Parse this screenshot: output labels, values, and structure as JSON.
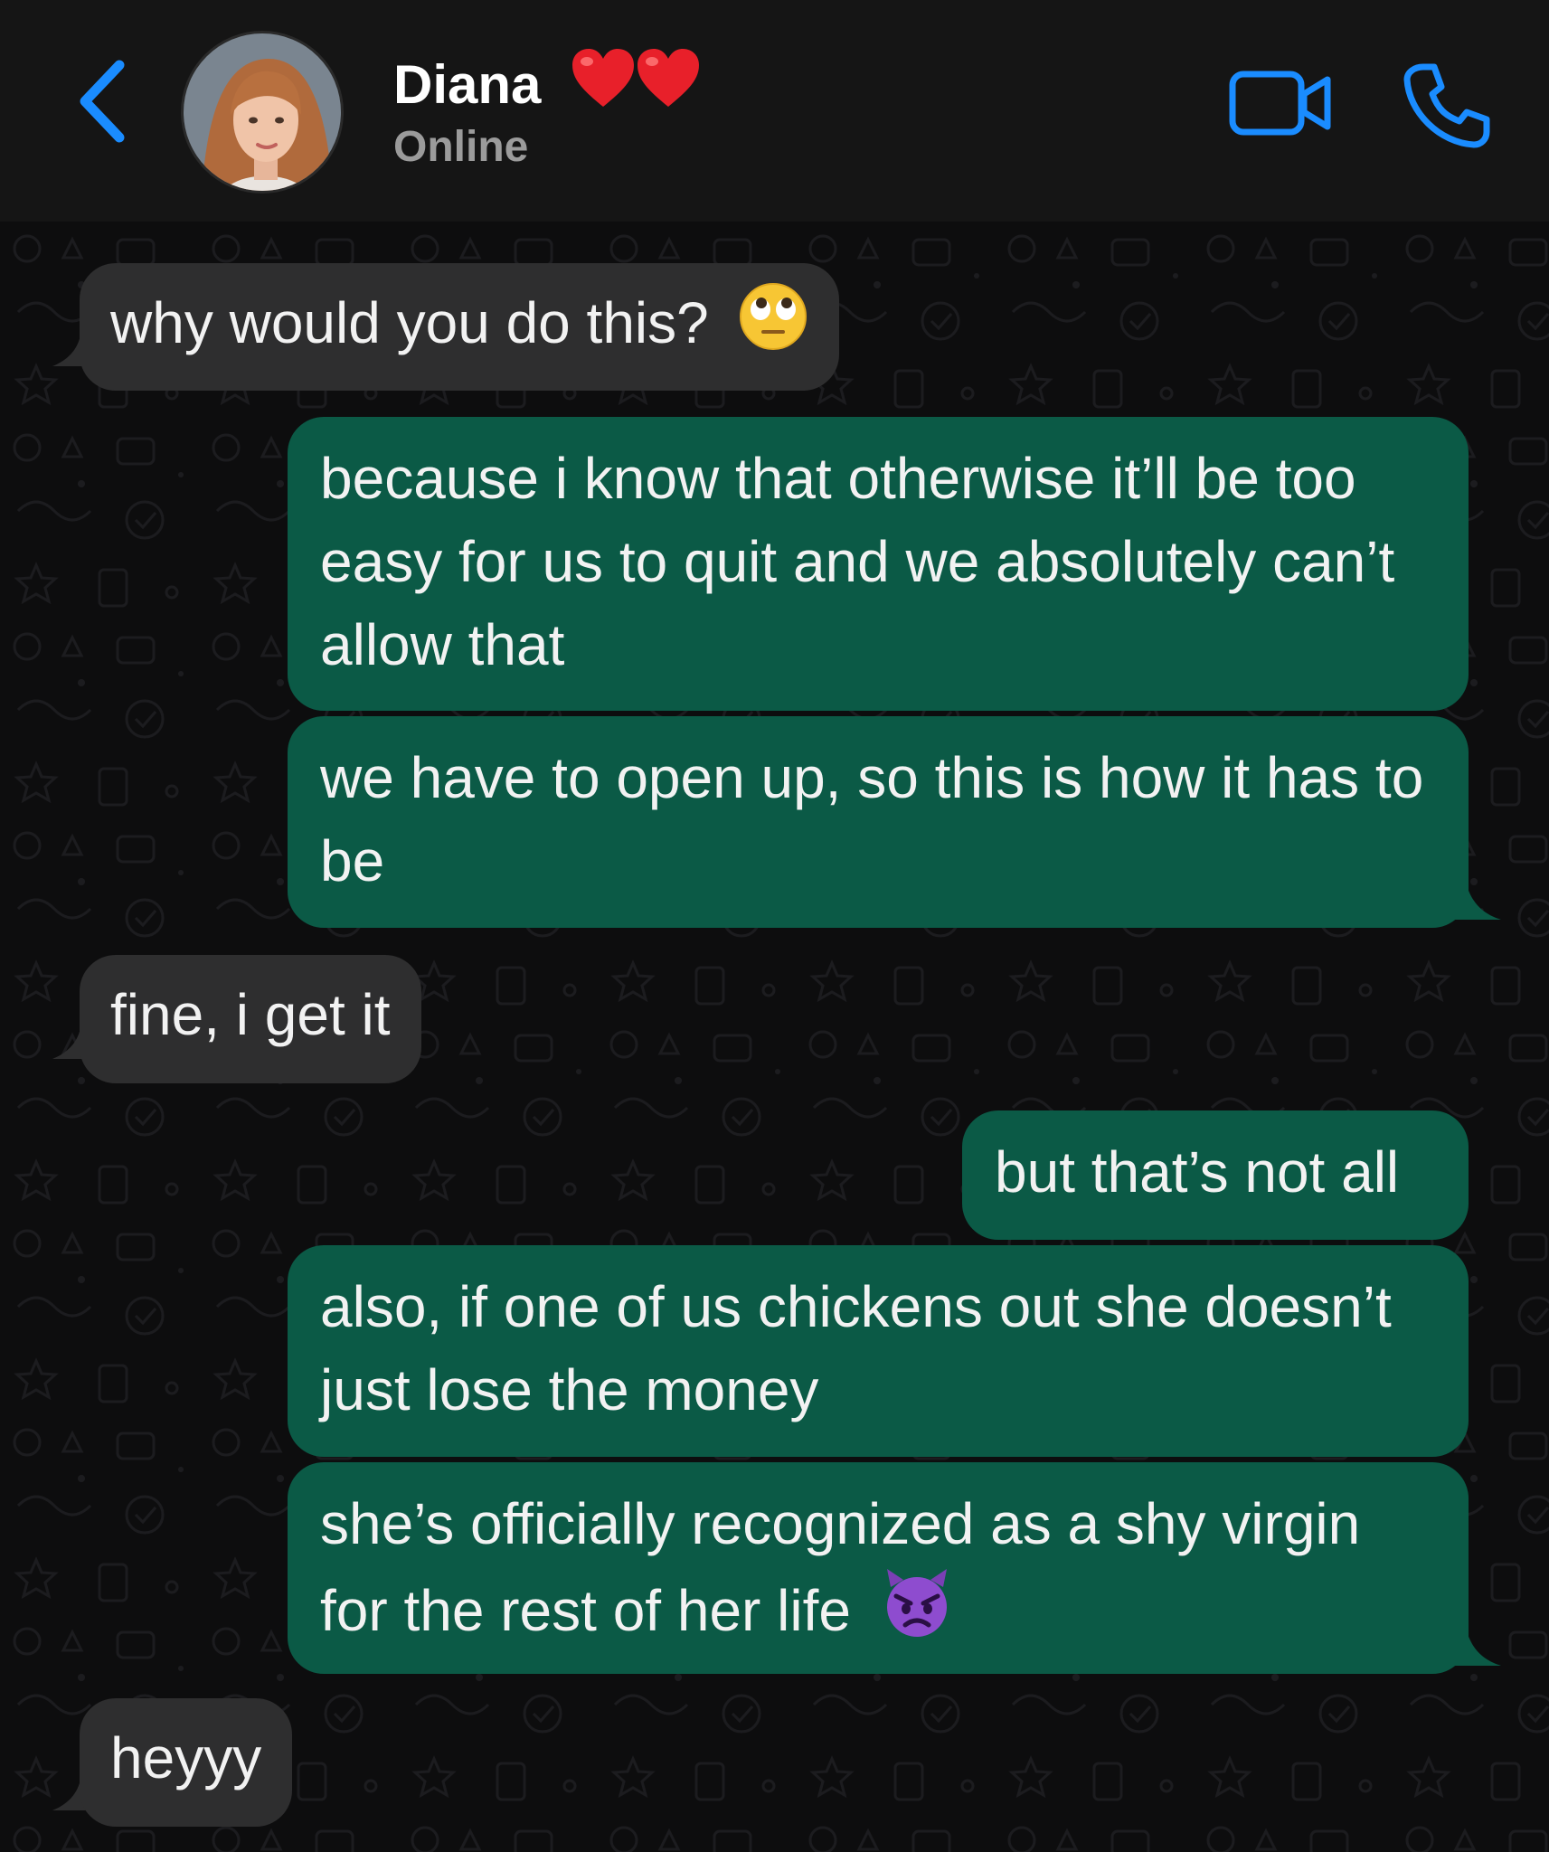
{
  "header": {
    "contact_name": "Diana",
    "name_emoji": "❤️❤️",
    "status": "Online",
    "back_icon": "chevron-left-icon",
    "video_icon": "video-camera-icon",
    "call_icon": "phone-icon",
    "accent_color": "#1a8cff"
  },
  "messages": [
    {
      "direction": "incoming",
      "text": "why would you do this?",
      "emoji": "eye-roll-emoji"
    },
    {
      "direction": "outgoing",
      "text": "because i know that otherwise it’ll be too easy for us to quit and we absolutely can’t allow that"
    },
    {
      "direction": "outgoing",
      "text": "we have to open up, so this is how it has to be"
    },
    {
      "direction": "incoming",
      "text": "fine, i get it"
    },
    {
      "direction": "outgoing",
      "text": "but that’s not all"
    },
    {
      "direction": "outgoing",
      "text": "also, if one of us chickens out she doesn’t just lose the money"
    },
    {
      "direction": "outgoing",
      "text": "she’s officially recognized as a shy virgin for the rest of her life",
      "emoji": "angry-devil-emoji"
    },
    {
      "direction": "incoming",
      "text": "heyyy"
    }
  ],
  "colors": {
    "incoming_bubble": "#2e2e2f",
    "outgoing_bubble": "#0b5a46",
    "header_bg": "#151515",
    "chat_bg": "#0d0d0e"
  }
}
